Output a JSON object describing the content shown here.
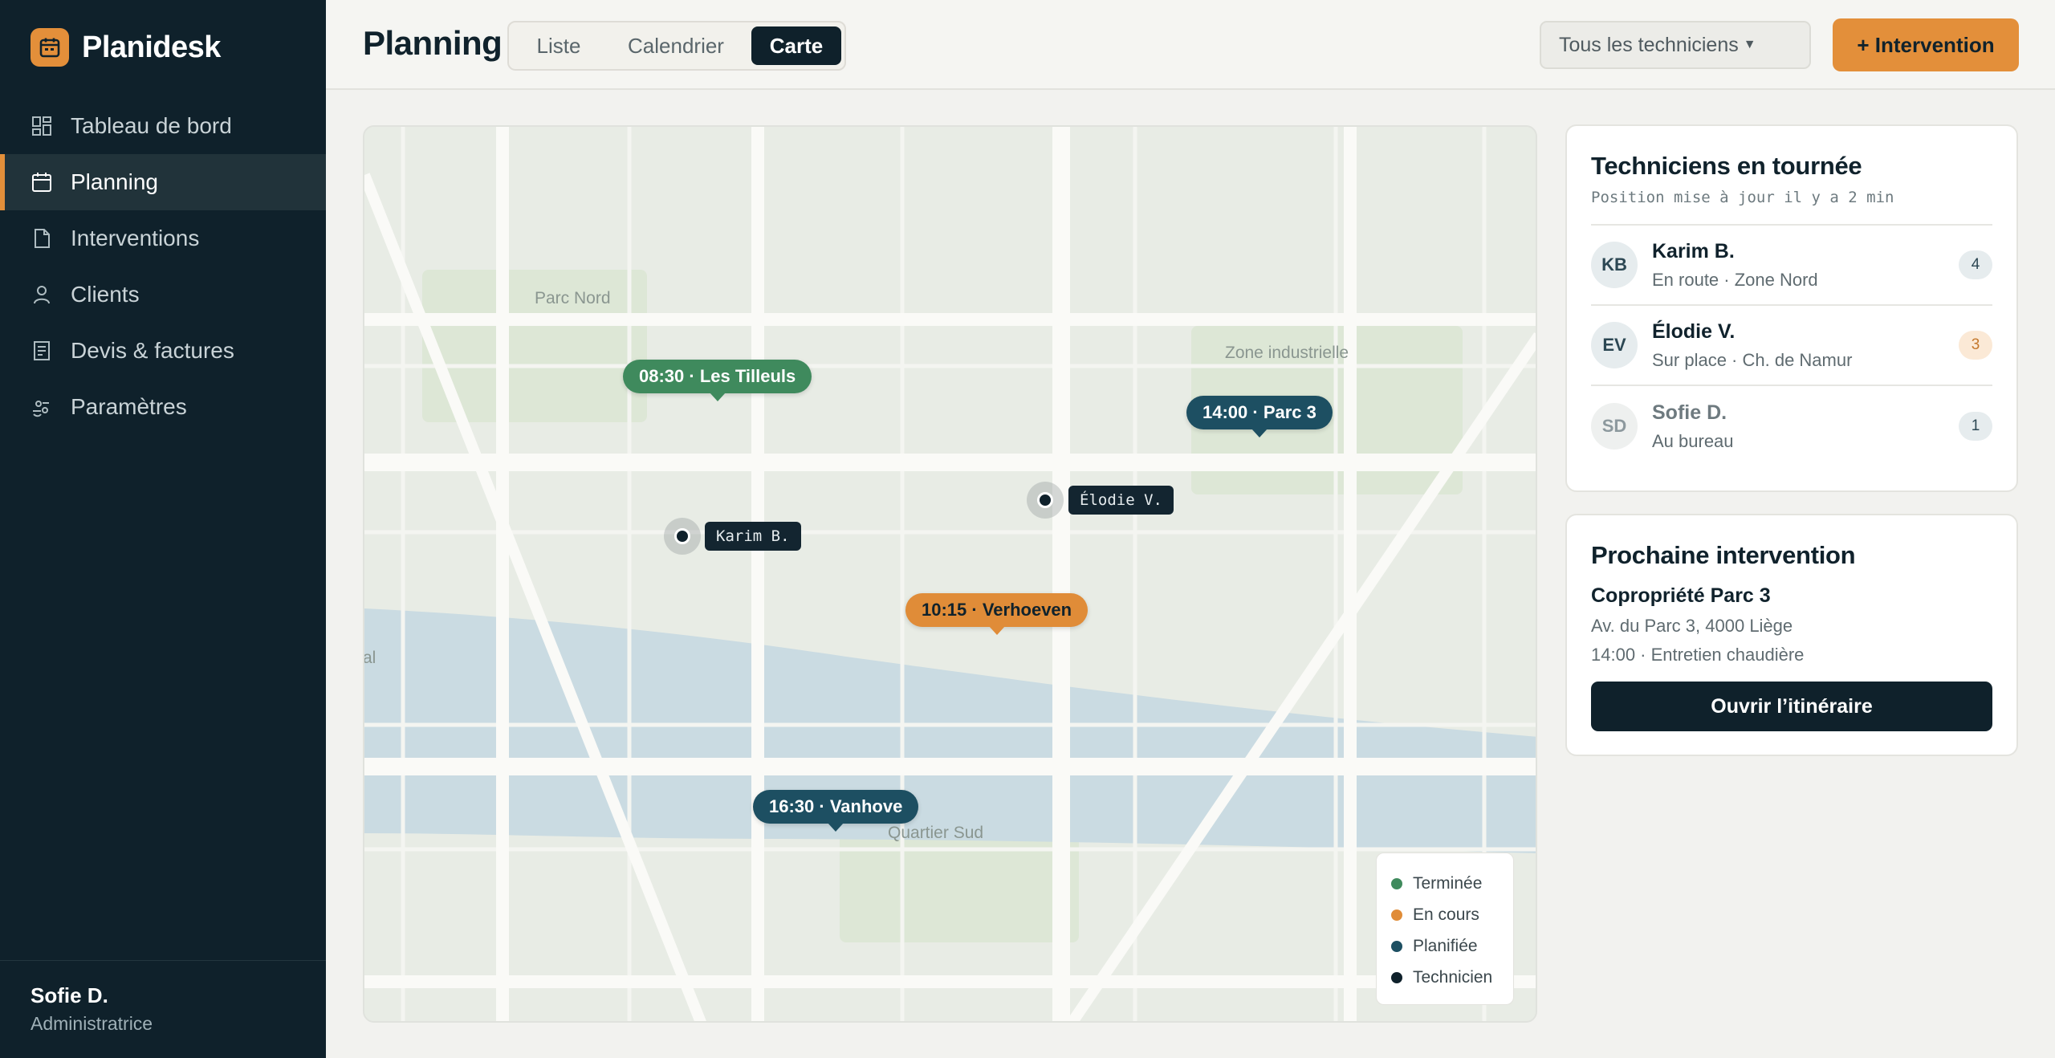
{
  "app": {
    "name": "Planidesk"
  },
  "sidebar": {
    "items": [
      {
        "label": "Tableau de bord",
        "icon": "dashboard-icon"
      },
      {
        "label": "Planning",
        "icon": "calendar-icon",
        "active": true
      },
      {
        "label": "Interventions",
        "icon": "document-icon"
      },
      {
        "label": "Clients",
        "icon": "user-icon"
      },
      {
        "label": "Devis & factures",
        "icon": "invoice-icon"
      },
      {
        "label": "Paramètres",
        "icon": "settings-icon"
      }
    ],
    "user": {
      "name": "Sofie D.",
      "role": "Administratrice"
    }
  },
  "header": {
    "title": "Planning",
    "views": [
      "Liste",
      "Calendrier",
      "Carte"
    ],
    "active_view": "Carte",
    "technician_filter": "Tous les techniciens",
    "add_button": "+ Intervention"
  },
  "map": {
    "areas": {
      "north_park": "Parc Nord",
      "industrial": "Zone industrielle",
      "south": "Quartier Sud",
      "canal_fragment": "al"
    },
    "pins": [
      {
        "label": "08:30 · Les Tilleuls",
        "status": "Terminée"
      },
      {
        "label": "14:00 · Parc 3",
        "status": "Planifiée"
      },
      {
        "label": "10:15 · Verhoeven",
        "status": "En cours"
      },
      {
        "label": "16:30 · Vanhove",
        "status": "Planifiée"
      }
    ],
    "technicians": [
      "Karim B.",
      "Élodie V."
    ],
    "legend": [
      {
        "label": "Terminée",
        "color": "#3f8a5d"
      },
      {
        "label": "En cours",
        "color": "#e08c38"
      },
      {
        "label": "Planifiée",
        "color": "#1d4f62"
      },
      {
        "label": "Technicien",
        "color": "#0f212b"
      }
    ]
  },
  "tour_panel": {
    "title": "Techniciens en tournée",
    "subtitle": "Position mise à jour il y a 2 min",
    "technicians": [
      {
        "initials": "KB",
        "name": "Karim B.",
        "status": "En route · Zone Nord",
        "count": "4"
      },
      {
        "initials": "EV",
        "name": "Élodie V.",
        "status": "Sur place · Ch. de Namur",
        "count": "3"
      },
      {
        "initials": "SD",
        "name": "Sofie D.",
        "status": "Au bureau",
        "count": "1"
      }
    ]
  },
  "next_panel": {
    "title": "Prochaine intervention",
    "client": "Copropriété Parc 3",
    "address": "Av. du Parc 3, 4000 Liège",
    "detail": "14:00 · Entretien chaudière",
    "button": "Ouvrir l’itinéraire"
  }
}
